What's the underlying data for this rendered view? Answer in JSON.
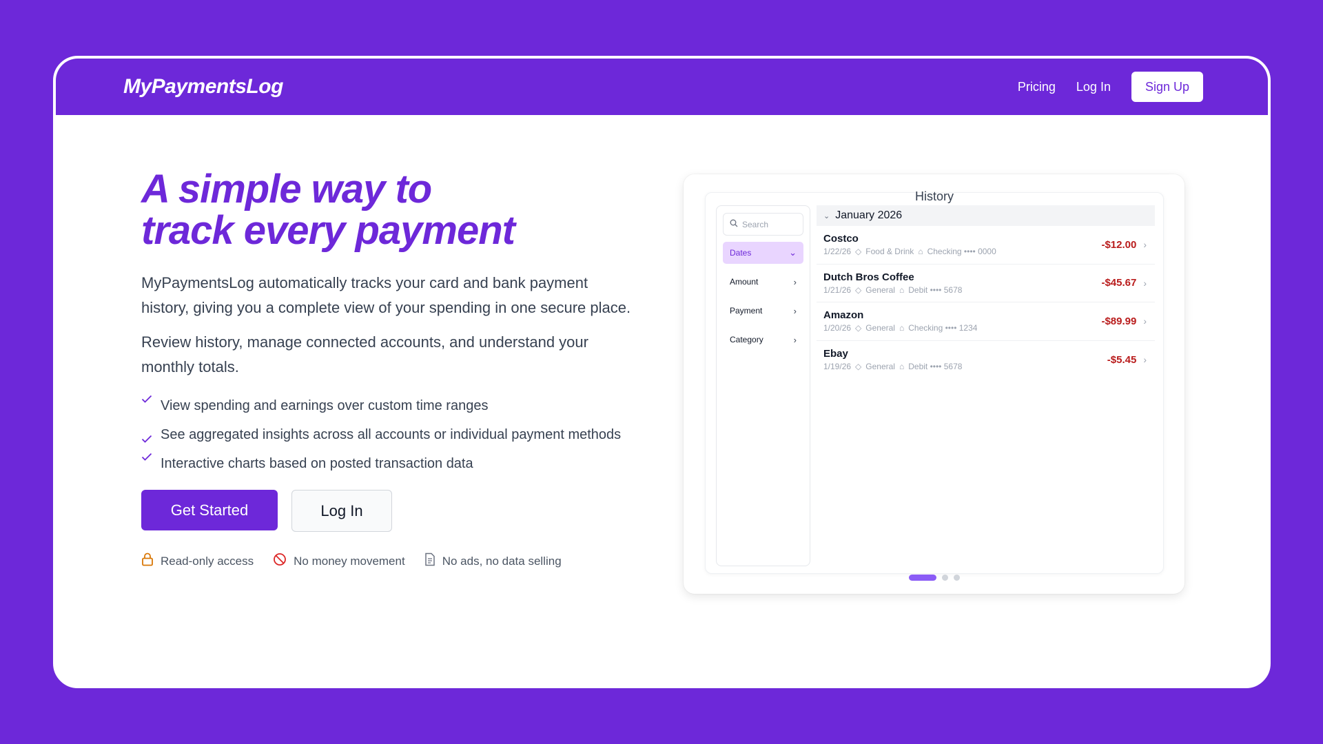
{
  "nav": {
    "logo": "MyPaymentsLog",
    "links": [
      "Pricing",
      "Log In"
    ],
    "signup": "Sign Up"
  },
  "hero": {
    "headline_line1": "A simple way to",
    "headline_line2": "track every payment",
    "paragraph1": "MyPaymentsLog automatically tracks your card and bank payment history, giving you a complete view of your spending in one secure place.",
    "paragraph2": "Review history, manage connected accounts, and understand your monthly totals.",
    "features": [
      "View spending and earnings over custom time ranges",
      "See aggregated insights across all accounts or individual payment methods",
      "Interactive charts based on posted transaction data"
    ],
    "cta_primary": "Get Started",
    "cta_secondary": "Log In",
    "trust": [
      "Read-only access",
      "No money movement",
      "No ads, no data selling"
    ]
  },
  "mockup": {
    "title": "History",
    "search_placeholder": "Search",
    "filters": [
      "Dates",
      "Amount",
      "Payment",
      "Category"
    ],
    "month": "January 2026",
    "transactions": [
      {
        "name": "Costco",
        "date": "1/22/26",
        "category": "Food & Drink",
        "account": "Checking •••• 0000",
        "amount": "-$12.00"
      },
      {
        "name": "Dutch Bros Coffee",
        "date": "1/21/26",
        "category": "General",
        "account": "Debit •••• 5678",
        "amount": "-$45.67"
      },
      {
        "name": "Amazon",
        "date": "1/20/26",
        "category": "General",
        "account": "Checking •••• 1234",
        "amount": "-$89.99"
      },
      {
        "name": "Ebay",
        "date": "1/19/26",
        "category": "General",
        "account": "Debit •••• 5678",
        "amount": "-$5.45"
      }
    ]
  },
  "colors": {
    "brand": "#6d28d9",
    "amount_negative": "#b91c1c"
  }
}
